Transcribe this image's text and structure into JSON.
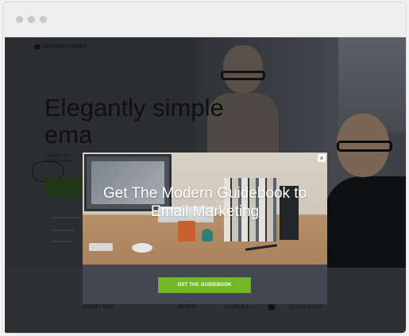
{
  "background_page": {
    "brand_name": "Campaign Monitor",
    "headline_line1": "Elegantly simple",
    "headline_line2": "ema",
    "subtext_line1": "Campaign Mon",
    "subtext_line2": "measure the su",
    "clients": [
      "BuzzFeed",
      "RIP CURL",
      "airbnb",
      "UNICEF",
      "Apple",
      "Coca-Cola"
    ]
  },
  "modal": {
    "title_line1": "Get The Modern Guidebook to",
    "title_line2": "Email Marketing",
    "cta_label": "GET THE GUIDEBOOK",
    "close_glyph": "×"
  },
  "icons": {
    "close": "close-icon",
    "apple": "apple-icon"
  },
  "colors": {
    "cta_green": "#74b828",
    "modal_bg": "#424752",
    "title_text": "#ffffff"
  }
}
